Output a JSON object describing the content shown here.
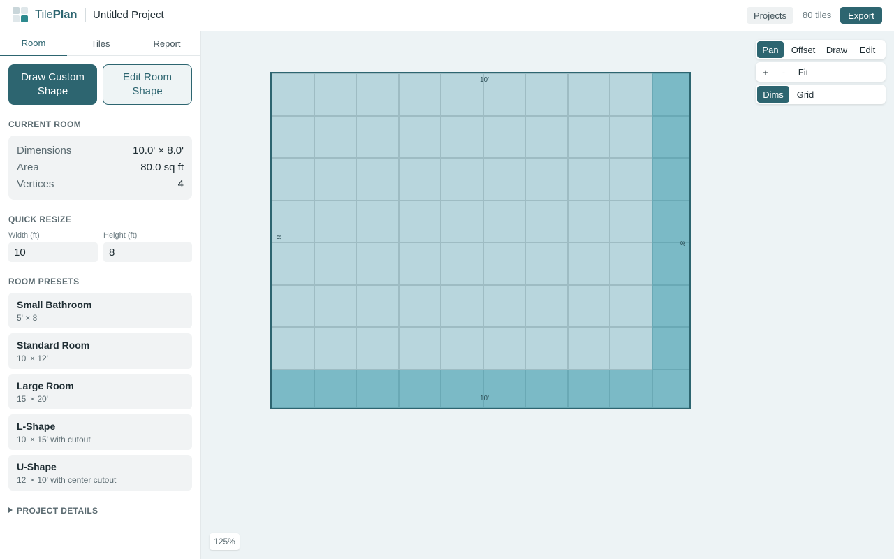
{
  "header": {
    "brand_part1": "Tile",
    "brand_part2": "Plan",
    "project_name": "Untitled Project",
    "projects_label": "Projects",
    "tile_count": "80 tiles",
    "export_label": "Export"
  },
  "sidebar": {
    "tabs": [
      "Room",
      "Tiles",
      "Report"
    ],
    "active_tab": "Room",
    "draw_button": "Draw Custom Shape",
    "edit_button": "Edit Room Shape",
    "current_room": {
      "title": "CURRENT ROOM",
      "rows": [
        {
          "label": "Dimensions",
          "value": "10.0' × 8.0'"
        },
        {
          "label": "Area",
          "value": "80.0 sq ft"
        },
        {
          "label": "Vertices",
          "value": "4"
        }
      ]
    },
    "quick_resize": {
      "title": "QUICK RESIZE",
      "width_label": "Width (ft)",
      "width_value": "10",
      "height_label": "Height (ft)",
      "height_value": "8"
    },
    "presets": {
      "title": "ROOM PRESETS",
      "items": [
        {
          "name": "Small Bathroom",
          "desc": "5' × 8'"
        },
        {
          "name": "Standard Room",
          "desc": "10' × 12'"
        },
        {
          "name": "Large Room",
          "desc": "15' × 20'"
        },
        {
          "name": "L-Shape",
          "desc": "10' × 15' with cutout"
        },
        {
          "name": "U-Shape",
          "desc": "12' × 10' with center cutout"
        }
      ]
    },
    "project_details": "PROJECT DETAILS"
  },
  "canvas": {
    "mode_tools": [
      "Pan",
      "Offset",
      "Draw",
      "Edit"
    ],
    "active_mode": "Pan",
    "zoom_tools": [
      "+",
      "-",
      "Fit"
    ],
    "view_toggles": [
      "Dims",
      "Grid"
    ],
    "active_view": "Dims",
    "dim_top": "10'",
    "dim_bottom": "10'",
    "dim_left": "8'",
    "dim_right": "8'",
    "zoom_level": "125%",
    "grid_columns": 10,
    "grid_rows": 8,
    "colors": {
      "tile": "#b8d6dd",
      "cut_tile": "#7bbac6",
      "room_border": "#2d6570"
    }
  }
}
